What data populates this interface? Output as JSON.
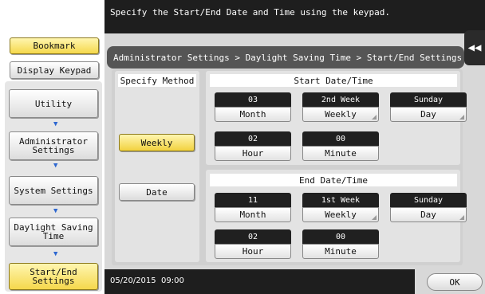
{
  "message": "Specify the Start/End Date and Time using the keypad.",
  "sidebar": {
    "bookmark": "Bookmark",
    "display_keypad": "Display Keypad",
    "nav": [
      "Utility",
      "Administrator Settings",
      "System Settings",
      "Daylight Saving Time",
      "Start/End Settings"
    ]
  },
  "breadcrumb": "Administrator Settings > Daylight Saving Time > Start/End Settings",
  "method": {
    "header": "Specify Method",
    "weekly": "Weekly",
    "date": "Date",
    "selected": "Weekly"
  },
  "start": {
    "header": "Start Date/Time",
    "month": {
      "value": "03",
      "label": "Month"
    },
    "week": {
      "value": "2nd Week",
      "label": "Weekly"
    },
    "day": {
      "value": "Sunday",
      "label": "Day"
    },
    "hour": {
      "value": "02",
      "label": "Hour"
    },
    "minute": {
      "value": "00",
      "label": "Minute"
    }
  },
  "end": {
    "header": "End Date/Time",
    "month": {
      "value": "11",
      "label": "Month"
    },
    "week": {
      "value": "1st Week",
      "label": "Weekly"
    },
    "day": {
      "value": "Sunday",
      "label": "Day"
    },
    "hour": {
      "value": "02",
      "label": "Hour"
    },
    "minute": {
      "value": "00",
      "label": "Minute"
    }
  },
  "status": {
    "datetime": "05/20/2015  09:00"
  },
  "ok_label": "OK",
  "icons": {
    "collapse": "double-left-arrow-icon",
    "nav_arrow": "down-arrow-icon"
  },
  "colors": {
    "highlight": "#f5d84c",
    "bar": "#1e1e1e",
    "arrow": "#2d67d0"
  }
}
